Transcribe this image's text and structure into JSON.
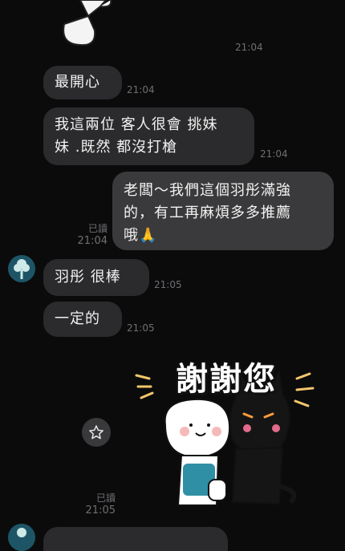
{
  "messages": [
    {
      "id": "m0",
      "time": "21:04"
    },
    {
      "id": "m1",
      "text": "最開心",
      "time": "21:04"
    },
    {
      "id": "m2",
      "text": "我這兩位 客人很會 挑妹妹 .既然 都沒打槍",
      "line1": "我這兩位 客人很會 挑妹",
      "line2": "妹 .既然 都沒打槍",
      "time": "21:04"
    },
    {
      "id": "m3",
      "line1": "老闆～我們這個羽彤滿強",
      "line2": "的，有工再麻煩多多推薦",
      "line3": "哦🙏",
      "read": "已讀",
      "time": "21:04"
    },
    {
      "id": "m4",
      "text": "羽彤 很棒",
      "time": "21:05"
    },
    {
      "id": "m5",
      "text": "一定的",
      "time": "21:05"
    },
    {
      "id": "m6",
      "sticker_text": "謝謝您",
      "read": "已讀",
      "time": "21:05"
    }
  ],
  "colors": {
    "background": "#0b0b0c",
    "incoming": "#2b2b2d",
    "outgoing": "#3a3a3c"
  },
  "icons": {
    "star": "star-outline-icon",
    "avatar": "tree-avatar-icon"
  }
}
